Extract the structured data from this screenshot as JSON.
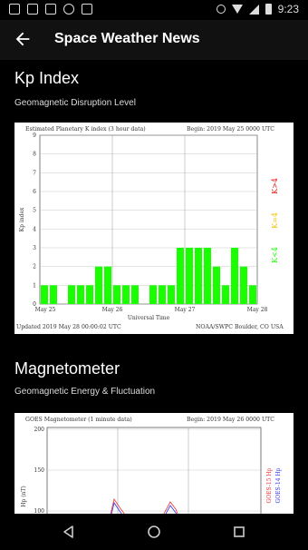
{
  "status": {
    "time": "9:23"
  },
  "appbar": {
    "title": "Space Weather News"
  },
  "kp": {
    "title": "Kp Index",
    "subtitle": "Geomagnetic Disruption Level",
    "chart": {
      "title": "Estimated Planetary K index (3 hour data)",
      "begin": "Begin: 2019 May 25 0000 UTC",
      "ylabel": "Kp index",
      "xlabel": "Universal Time",
      "date_labels": [
        "May 25",
        "May 26",
        "May 27",
        "May 28"
      ],
      "y_ticks": [
        "0",
        "1",
        "2",
        "3",
        "4",
        "5",
        "6",
        "7",
        "8",
        "9"
      ],
      "legend": [
        "K<4",
        "K=4",
        "K>4"
      ],
      "updated": "Updated 2019 May 28 00:00:02 UTC",
      "credit": "NOAA/SWPC Boulder, CO USA",
      "colors": {
        "quiet": "#1aff00",
        "active": "#f2c200",
        "storm": "#ee1111"
      }
    }
  },
  "magnetometer": {
    "title": "Magnetometer",
    "subtitle": "Geomagnetic Energy & Fluctuation",
    "chart": {
      "title": "GOES Magnetometer (1 minute data)",
      "begin": "Begin: 2019 May 26 0000 UTC",
      "y_ticks": [
        "200",
        "150",
        "100"
      ],
      "ylabel": "Hp (nT)",
      "legend": [
        "GOES-15 Hp",
        "GOES-14 Hp"
      ]
    }
  },
  "chart_data": [
    {
      "type": "bar",
      "title": "Estimated Planetary K index (3 hour data)",
      "xlabel": "Universal Time",
      "ylabel": "Kp index",
      "ylim": [
        0,
        9
      ],
      "grid": true,
      "x_labels": [
        "May 25",
        "May 26",
        "May 27",
        "May 28"
      ],
      "values": [
        1,
        1,
        0,
        1,
        1,
        1,
        2,
        2,
        1,
        1,
        1,
        0,
        1,
        1,
        1,
        3,
        3,
        3,
        3,
        2,
        1,
        3,
        2,
        1
      ]
    }
  ]
}
